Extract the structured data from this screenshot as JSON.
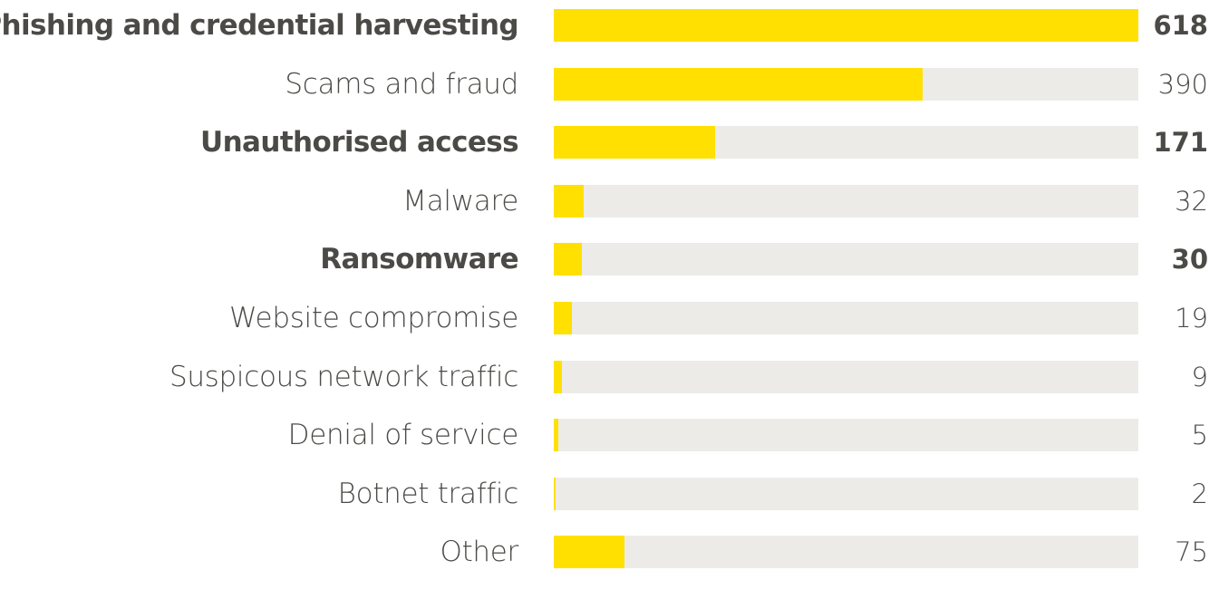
{
  "chart_data": {
    "type": "bar",
    "orientation": "horizontal",
    "title": "",
    "xlabel": "",
    "ylabel": "",
    "xlim": [
      0,
      618
    ],
    "grid": false,
    "legend": "none",
    "colors": {
      "fill": "#ffe000",
      "track": "#ecebe8",
      "text": "#4b4a47"
    },
    "categories": [
      "Phishing and credential harvesting",
      "Scams and fraud",
      "Unauthorised access",
      "Malware",
      "Ransomware",
      "Website compromise",
      "Suspicous network traffic",
      "Denial of service",
      "Botnet traffic",
      "Other"
    ],
    "values": [
      618,
      390,
      171,
      32,
      30,
      19,
      9,
      5,
      2,
      75
    ],
    "emphasized": [
      true,
      false,
      true,
      false,
      true,
      false,
      false,
      false,
      false,
      false
    ]
  }
}
